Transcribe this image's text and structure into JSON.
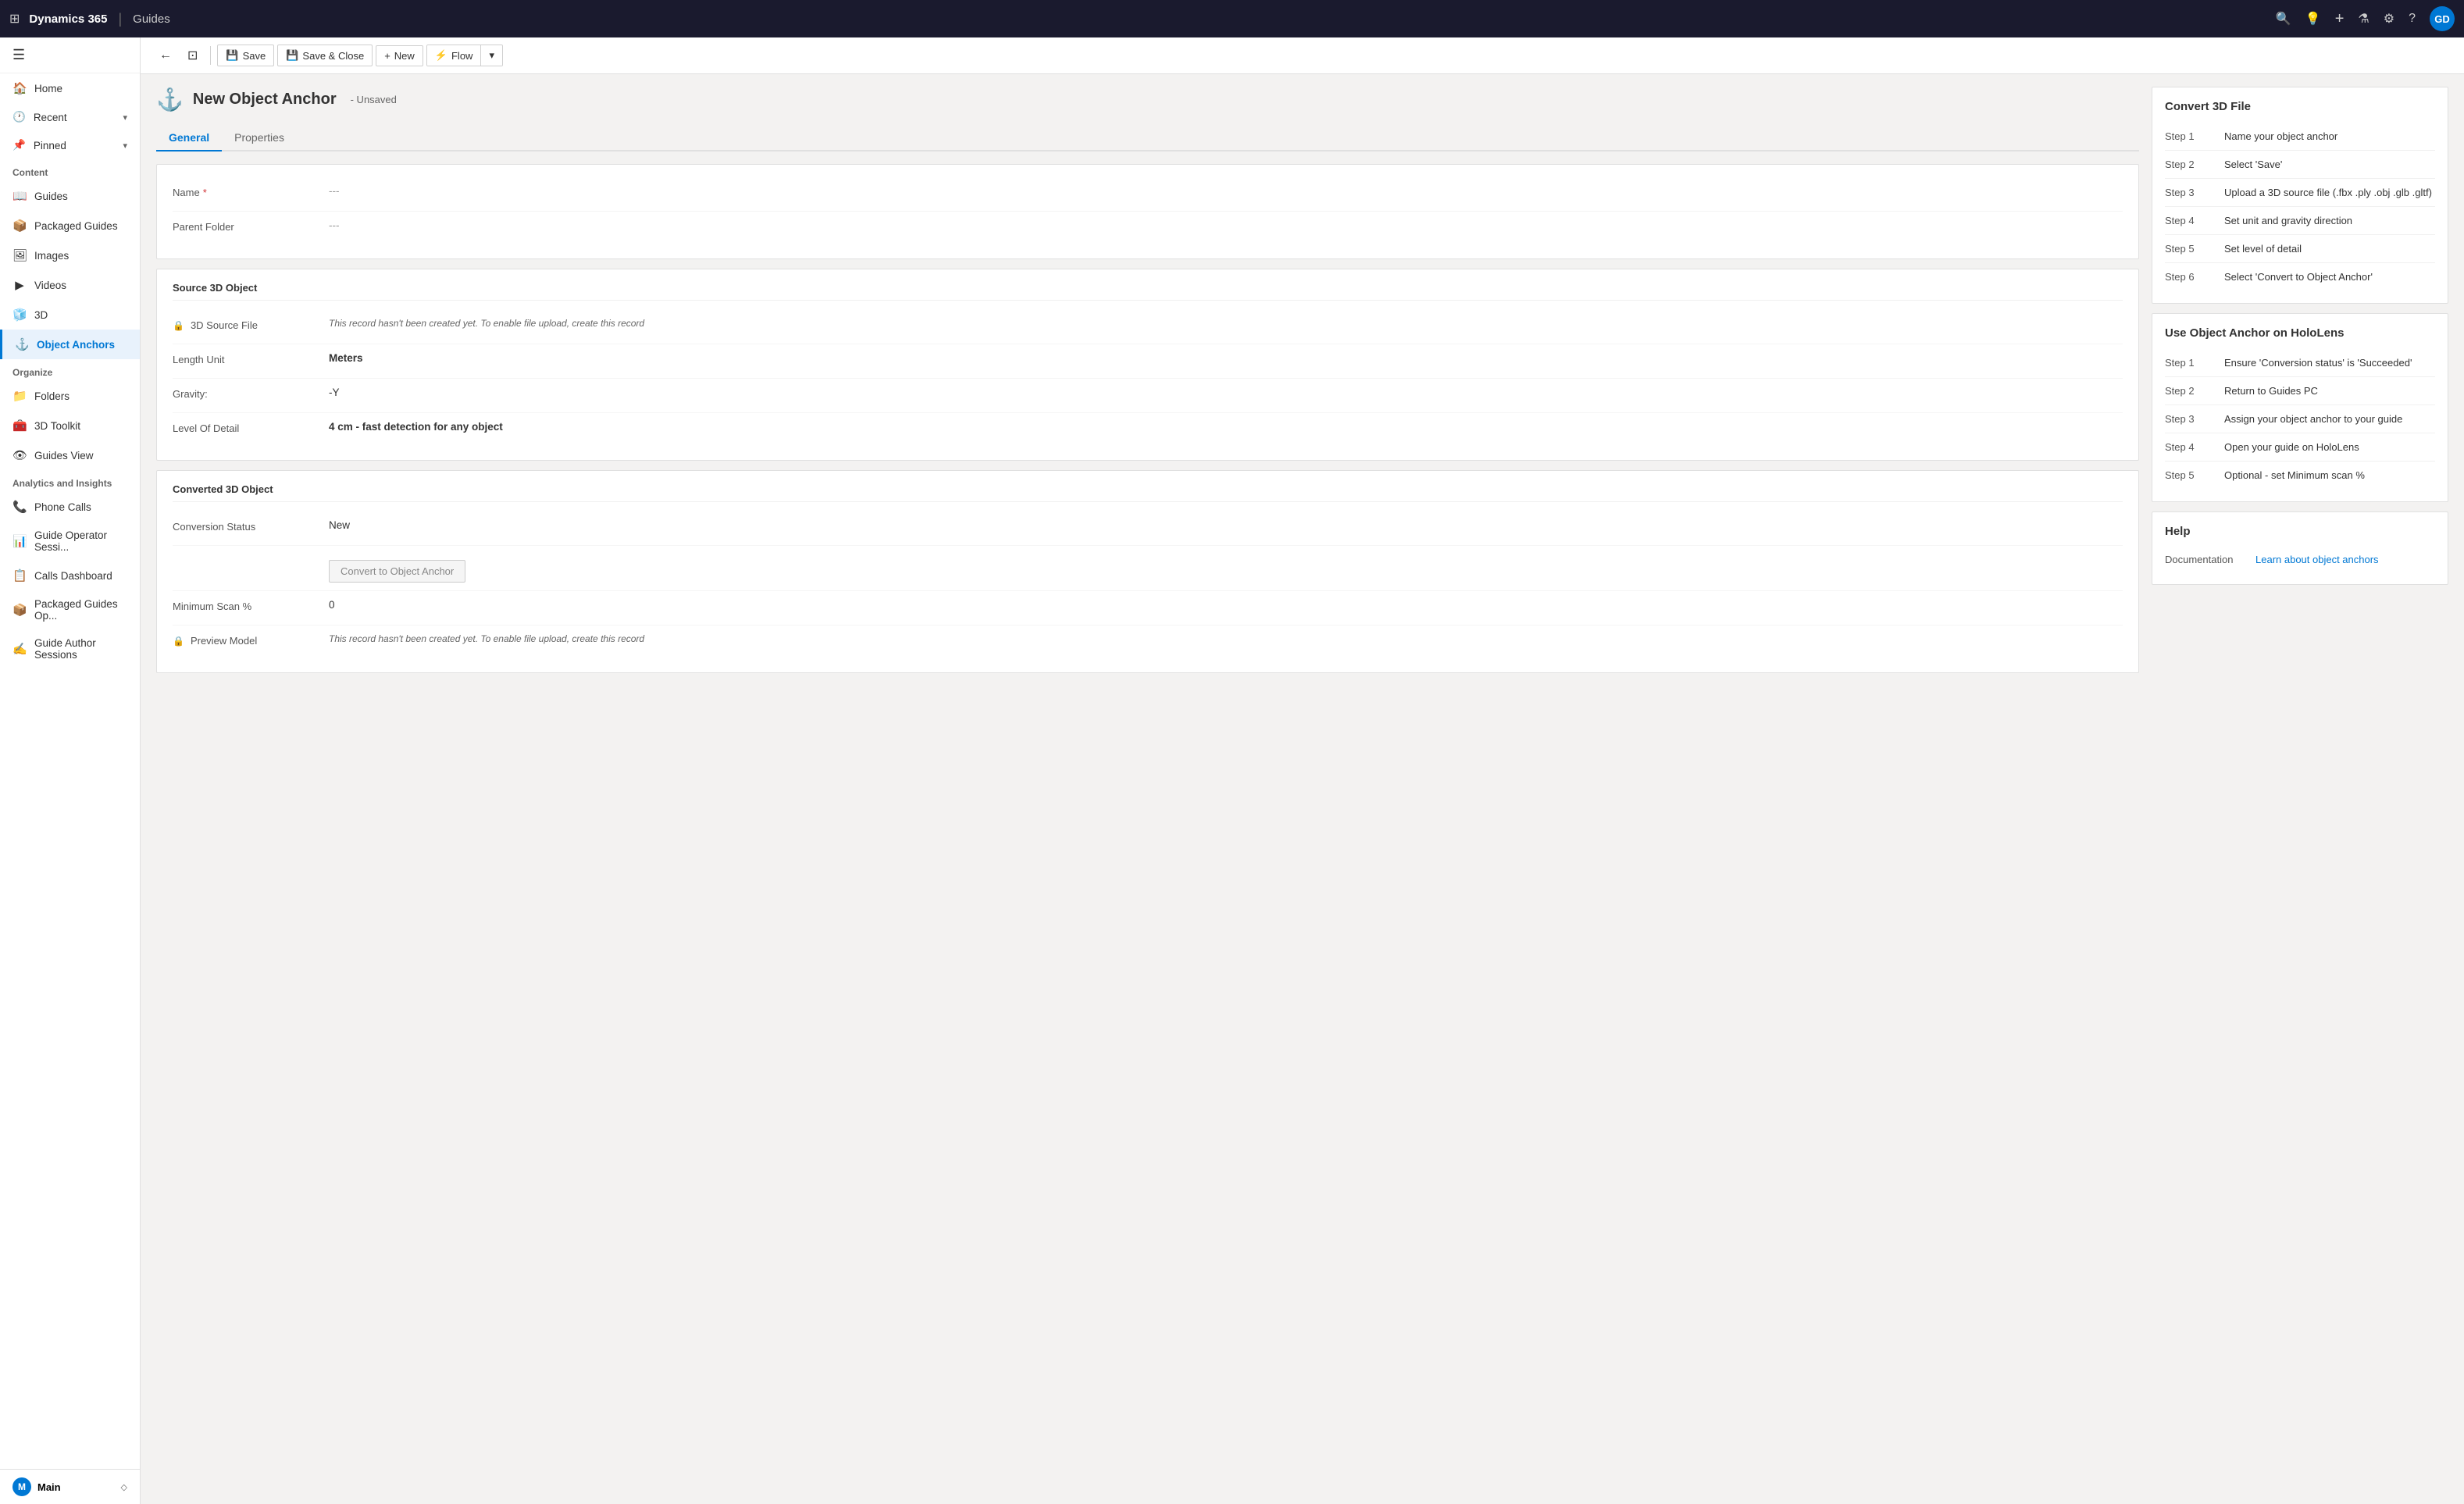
{
  "topNav": {
    "waffle": "⊞",
    "appName": "Dynamics 365",
    "separator": "|",
    "moduleName": "Guides",
    "searchIcon": "🔍",
    "lightbulbIcon": "💡",
    "addIcon": "+",
    "filterIcon": "⚗",
    "settingsIcon": "⚙",
    "helpIcon": "?",
    "avatarText": "GD"
  },
  "toolbar": {
    "backIcon": "←",
    "refreshIcon": "⊡",
    "saveLabel": "Save",
    "saveCloseLabel": "Save & Close",
    "newLabel": "New",
    "flowLabel": "Flow",
    "dropdownIcon": "▾"
  },
  "record": {
    "icon": "⚓",
    "title": "New Object Anchor",
    "statusLabel": "- Unsaved"
  },
  "tabs": [
    {
      "label": "General",
      "active": true
    },
    {
      "label": "Properties",
      "active": false
    }
  ],
  "formSections": {
    "basic": {
      "nameLabel": "Name",
      "nameRequired": true,
      "nameValue": "---",
      "parentFolderLabel": "Parent Folder",
      "parentFolderValue": "---"
    },
    "source3DObject": {
      "title": "Source 3D Object",
      "sourceFileLabel": "3D Source File",
      "sourceFileLocked": true,
      "sourceFileNote": "This record hasn't been created yet. To enable file upload, create this record",
      "lengthUnitLabel": "Length Unit",
      "lengthUnitValue": "Meters",
      "gravityLabel": "Gravity:",
      "gravityValue": "-Y",
      "levelOfDetailLabel": "Level Of Detail",
      "levelOfDetailValue": "4 cm - fast detection for any object"
    },
    "converted3DObject": {
      "title": "Converted 3D Object",
      "conversionStatusLabel": "Conversion Status",
      "conversionStatusValue": "New",
      "convertBtnLabel": "Convert to Object Anchor",
      "minimumScanLabel": "Minimum Scan %",
      "minimumScanValue": "0",
      "previewModelLabel": "Preview Model",
      "previewModelLocked": true,
      "previewModelNote": "This record hasn't been created yet. To enable file upload, create this record"
    }
  },
  "rightPanel": {
    "convert3DFile": {
      "title": "Convert 3D File",
      "steps": [
        {
          "label": "Step 1",
          "text": "Name your object anchor"
        },
        {
          "label": "Step 2",
          "text": "Select 'Save'"
        },
        {
          "label": "Step 3",
          "text": "Upload a 3D source file (.fbx .ply .obj .glb .gltf)"
        },
        {
          "label": "Step 4",
          "text": "Set unit and gravity direction"
        },
        {
          "label": "Step 5",
          "text": "Set level of detail"
        },
        {
          "label": "Step 6",
          "text": "Select 'Convert to Object Anchor'"
        }
      ]
    },
    "useOnHoloLens": {
      "title": "Use Object Anchor on HoloLens",
      "steps": [
        {
          "label": "Step 1",
          "text": "Ensure 'Conversion status' is 'Succeeded'"
        },
        {
          "label": "Step 2",
          "text": "Return to Guides PC"
        },
        {
          "label": "Step 3",
          "text": "Assign your object anchor to your guide"
        },
        {
          "label": "Step 4",
          "text": "Open your guide on HoloLens"
        },
        {
          "label": "Step 5",
          "text": "Optional - set Minimum scan %"
        }
      ]
    },
    "help": {
      "title": "Help",
      "documentationLabel": "Documentation",
      "learnLinkText": "Learn about object anchors",
      "learnLinkHref": "#"
    }
  },
  "sidebar": {
    "toggleIcon": "☰",
    "homeLabel": "Home",
    "recentLabel": "Recent",
    "pinnedLabel": "Pinned",
    "contentSection": "Content",
    "items": [
      {
        "label": "Guides",
        "icon": "📖"
      },
      {
        "label": "Packaged Guides",
        "icon": "📦"
      },
      {
        "label": "Images",
        "icon": "🖼"
      },
      {
        "label": "Videos",
        "icon": "▶"
      },
      {
        "label": "3D",
        "icon": "🧊"
      },
      {
        "label": "Object Anchors",
        "icon": "⚓",
        "active": true
      }
    ],
    "organizeSection": "Organize",
    "organizeItems": [
      {
        "label": "Folders",
        "icon": "📁"
      },
      {
        "label": "3D Toolkit",
        "icon": "🧰"
      },
      {
        "label": "Guides View",
        "icon": "👁"
      }
    ],
    "analyticsSection": "Analytics and Insights",
    "analyticsItems": [
      {
        "label": "Phone Calls",
        "icon": "📞"
      },
      {
        "label": "Guide Operator Sessi...",
        "icon": "📊"
      },
      {
        "label": "Calls Dashboard",
        "icon": "📋"
      },
      {
        "label": "Packaged Guides Op...",
        "icon": "📦"
      },
      {
        "label": "Guide Author Sessions",
        "icon": "✍"
      }
    ],
    "footer": {
      "iconText": "M",
      "label": "Main",
      "arrowIcon": "◇"
    }
  }
}
